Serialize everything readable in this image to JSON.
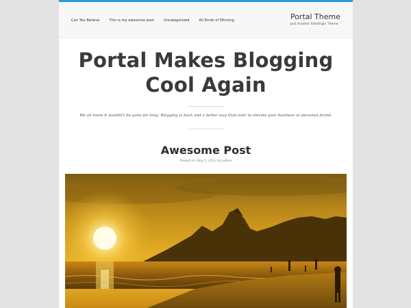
{
  "header": {
    "nav": [
      "Can You Believe",
      "This is my awesome post",
      "Uncategorized",
      "All Kinds of Winning"
    ],
    "site_title": "Portal Theme",
    "site_tagline": "Just Another SiteOrigin Theme"
  },
  "hero": {
    "title_line1": "Portal Makes Blogging",
    "title_line2": "Cool Again",
    "description": "We all knew it wouldn't be gone for long. Blogging is back and a better way than ever to elevate your business or personal brand."
  },
  "post": {
    "title": "Awesome Post",
    "meta_prefix": "Posted on",
    "date": "May 5, 2013",
    "meta_by": "by",
    "author": "admin",
    "image_alt": "sunset-beach-photo"
  },
  "colors": {
    "accent": "#2d9ad8",
    "background": "#e3e3e3"
  }
}
